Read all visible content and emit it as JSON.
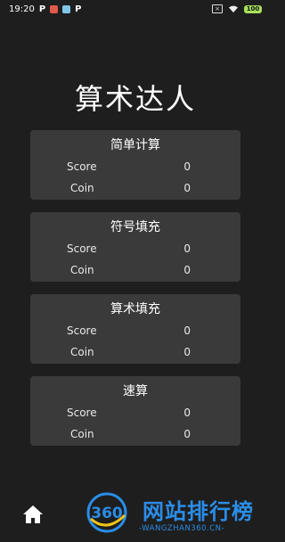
{
  "status_bar": {
    "time": "19:20",
    "battery": "100",
    "colors": {
      "app_icon_1": "#e05a4a",
      "app_icon_2": "#7fc6e6",
      "battery": "#a6e05a"
    }
  },
  "title": "算术达人",
  "cards": [
    {
      "title": "简单计算",
      "score_label": "Score",
      "score": "0",
      "coin_label": "Coin",
      "coin": "0"
    },
    {
      "title": "符号填充",
      "score_label": "Score",
      "score": "0",
      "coin_label": "Coin",
      "coin": "0"
    },
    {
      "title": "算术填充",
      "score_label": "Score",
      "score": "0",
      "coin_label": "Coin",
      "coin": "0"
    },
    {
      "title": "速算",
      "score_label": "Score",
      "score": "0",
      "coin_label": "Coin",
      "coin": "0"
    }
  ],
  "bottom": {
    "home_icon": "home-icon",
    "watermark_text": "网站排行榜",
    "watermark_sub": "-WANGZHAN360.CN-",
    "watermark_logo": "360"
  }
}
